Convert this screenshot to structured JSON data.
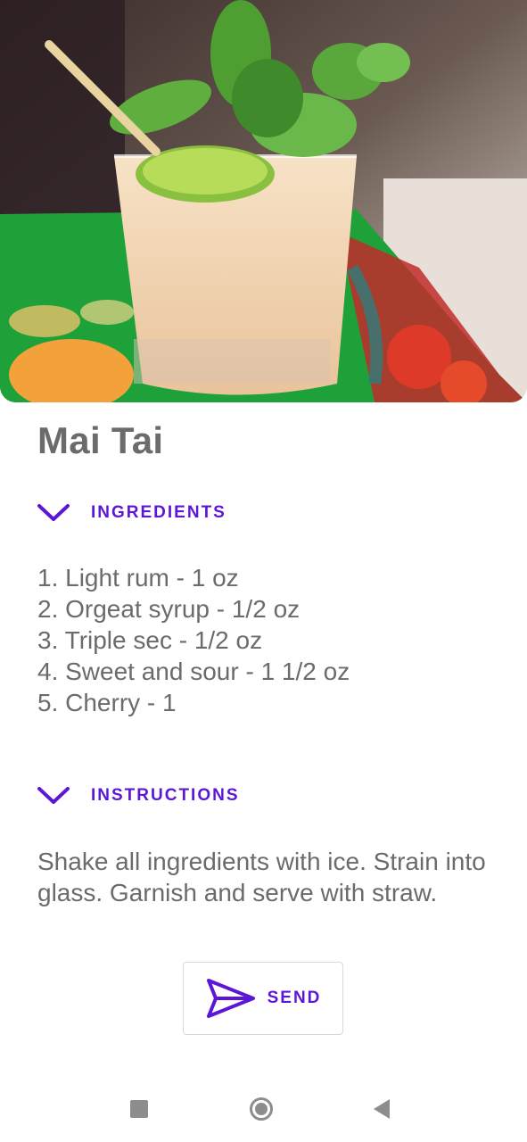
{
  "hero": {
    "image_alt": "Mai Tai cocktail garnished with mint and lime"
  },
  "cocktail": {
    "name": "Mai Tai"
  },
  "ingredients": {
    "label": "INGREDIENTS",
    "items": [
      "1. Light rum - 1 oz",
      "2. Orgeat syrup - 1/2 oz",
      "3. Triple sec - 1/2 oz",
      "4. Sweet and sour - 1 1/2 oz",
      "5. Cherry - 1"
    ]
  },
  "instructions": {
    "label": "INSTRUCTIONS",
    "text": "Shake all ingredients with ice. Strain into glass. Garnish and serve with straw."
  },
  "send_button": {
    "label": "SEND",
    "icon": "send-icon"
  },
  "nav_bar": {
    "recent": "recent-apps-icon",
    "home": "home-icon",
    "back": "back-icon"
  },
  "colors": {
    "accent": "#5b16d6",
    "text": "#6b6b6b",
    "nav_icons": "#8d8d8d"
  }
}
